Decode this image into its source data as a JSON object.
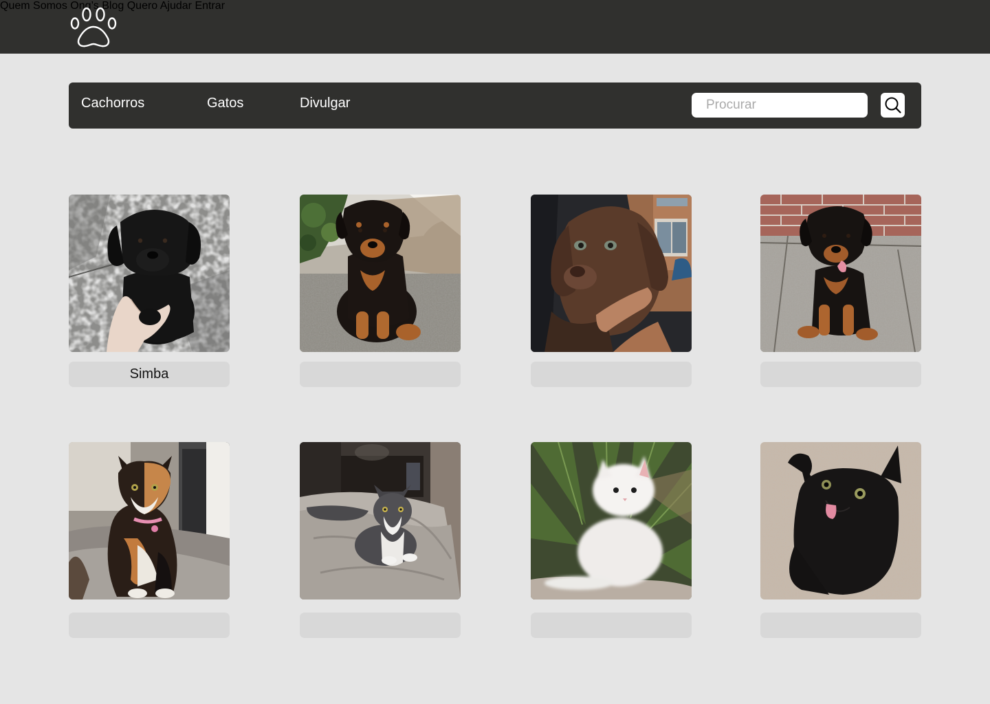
{
  "header": {
    "logo": "paw-logo",
    "nav": [
      {
        "label": "Quem Somos"
      },
      {
        "label": "Ong’s"
      },
      {
        "label": "Blog"
      },
      {
        "label": "Quero Ajudar"
      },
      {
        "label": "Entrar"
      }
    ]
  },
  "filters": {
    "categories": [
      {
        "label": "Cachorros"
      },
      {
        "label": "Gatos"
      },
      {
        "label": "Divulgar"
      }
    ],
    "search": {
      "placeholder": "Procurar",
      "value": "",
      "icon": "search-icon"
    }
  },
  "pets": [
    {
      "name": "Simba",
      "photo": "black-labrador-puppy"
    },
    {
      "name": "",
      "photo": "rottweiler-puppy-on-stone"
    },
    {
      "name": "",
      "photo": "chocolate-labrador-puppy"
    },
    {
      "name": "",
      "photo": "rottweiler-puppy-on-wood"
    },
    {
      "name": "",
      "photo": "calico-cat"
    },
    {
      "name": "",
      "photo": "gray-white-cat-on-bed"
    },
    {
      "name": "",
      "photo": "white-fluffy-kitten"
    },
    {
      "name": "",
      "photo": "black-cat-tongue-out"
    }
  ],
  "colors": {
    "header_bg": "#30302e",
    "page_bg": "#e5e5e5",
    "name_tag_bg": "#d8d8d8"
  }
}
